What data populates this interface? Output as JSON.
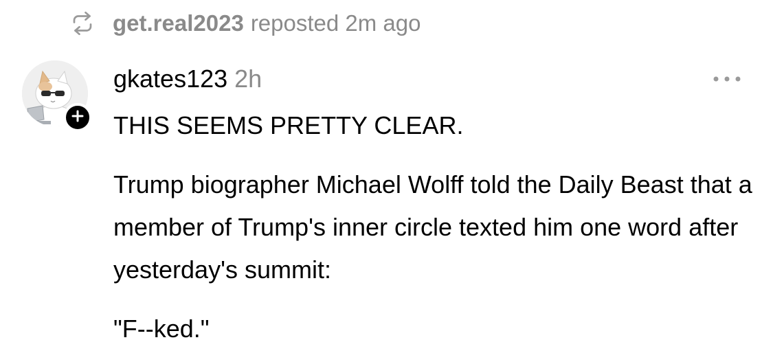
{
  "repost": {
    "icon": "repost-icon",
    "user": "get.real2023",
    "text": "reposted 2m ago"
  },
  "post": {
    "avatar_icon": "cat-avatar",
    "follow_icon": "plus-icon",
    "username": "gkates123",
    "time": "2h",
    "more_icon": "more-horizontal-icon",
    "paragraphs": [
      "THIS SEEMS PRETTY CLEAR.",
      "Trump biographer Michael Wolff told the Daily Beast that a member of Trump's inner circle texted him one word after yesterday's summit:",
      "\"F--ked.\""
    ]
  },
  "colors": {
    "text": "#000000",
    "muted": "#8a8a8a",
    "background": "#ffffff"
  }
}
